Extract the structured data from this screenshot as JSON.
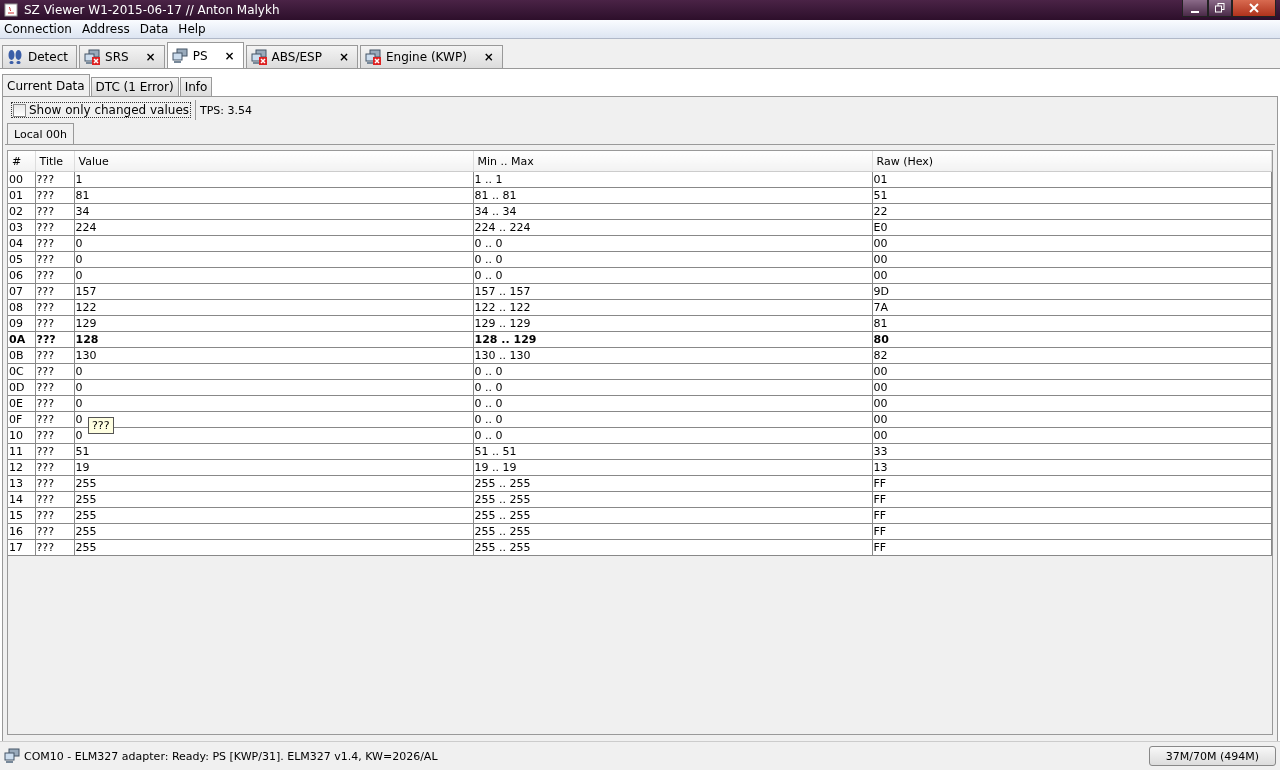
{
  "window": {
    "title": "SZ Viewer W1-2015-06-17 // Anton Malykh"
  },
  "menu": [
    "Connection",
    "Address",
    "Data",
    "Help"
  ],
  "device_tabs": [
    {
      "label": "Detect",
      "kind": "detect",
      "closable": false,
      "selected": false
    },
    {
      "label": "SRS",
      "kind": "error",
      "closable": true,
      "selected": false
    },
    {
      "label": "PS",
      "kind": "ok",
      "closable": true,
      "selected": true
    },
    {
      "label": "ABS/ESP",
      "kind": "error",
      "closable": true,
      "selected": false
    },
    {
      "label": "Engine (KWP)",
      "kind": "error",
      "closable": true,
      "selected": false
    }
  ],
  "close_glyph": "×",
  "sub_tabs": [
    {
      "label": "Current Data",
      "selected": true
    },
    {
      "label": "DTC (1 Error)",
      "selected": false
    },
    {
      "label": "Info",
      "selected": false
    }
  ],
  "filter": {
    "label": "Show only changed values",
    "checked": false
  },
  "tps": "TPS: 3.54",
  "block_tabs": [
    {
      "label": "Local 00h",
      "selected": true
    }
  ],
  "table": {
    "columns": [
      "#",
      "Title",
      "Value",
      "Min .. Max",
      "Raw (Hex)"
    ],
    "rows": [
      {
        "cells": [
          "00",
          "???",
          "1",
          "1 .. 1",
          "01"
        ],
        "bold": false
      },
      {
        "cells": [
          "01",
          "???",
          "81",
          "81 .. 81",
          "51"
        ],
        "bold": false
      },
      {
        "cells": [
          "02",
          "???",
          "34",
          "34 .. 34",
          "22"
        ],
        "bold": false
      },
      {
        "cells": [
          "03",
          "???",
          "224",
          "224 .. 224",
          "E0"
        ],
        "bold": false
      },
      {
        "cells": [
          "04",
          "???",
          "0",
          "0 .. 0",
          "00"
        ],
        "bold": false
      },
      {
        "cells": [
          "05",
          "???",
          "0",
          "0 .. 0",
          "00"
        ],
        "bold": false
      },
      {
        "cells": [
          "06",
          "???",
          "0",
          "0 .. 0",
          "00"
        ],
        "bold": false
      },
      {
        "cells": [
          "07",
          "???",
          "157",
          "157 .. 157",
          "9D"
        ],
        "bold": false
      },
      {
        "cells": [
          "08",
          "???",
          "122",
          "122 .. 122",
          "7A"
        ],
        "bold": false
      },
      {
        "cells": [
          "09",
          "???",
          "129",
          "129 .. 129",
          "81"
        ],
        "bold": false
      },
      {
        "cells": [
          "0A",
          "???",
          "128",
          "128 .. 129",
          "80"
        ],
        "bold": true
      },
      {
        "cells": [
          "0B",
          "???",
          "130",
          "130 .. 130",
          "82"
        ],
        "bold": false
      },
      {
        "cells": [
          "0C",
          "???",
          "0",
          "0 .. 0",
          "00"
        ],
        "bold": false
      },
      {
        "cells": [
          "0D",
          "???",
          "0",
          "0 .. 0",
          "00"
        ],
        "bold": false
      },
      {
        "cells": [
          "0E",
          "???",
          "0",
          "0 .. 0",
          "00"
        ],
        "bold": false
      },
      {
        "cells": [
          "0F",
          "???",
          "0",
          "0 .. 0",
          "00"
        ],
        "bold": false
      },
      {
        "cells": [
          "10",
          "???",
          "0",
          "0 .. 0",
          "00"
        ],
        "bold": false
      },
      {
        "cells": [
          "11",
          "???",
          "51",
          "51 .. 51",
          "33"
        ],
        "bold": false
      },
      {
        "cells": [
          "12",
          "???",
          "19",
          "19 .. 19",
          "13"
        ],
        "bold": false
      },
      {
        "cells": [
          "13",
          "???",
          "255",
          "255 .. 255",
          "FF"
        ],
        "bold": false
      },
      {
        "cells": [
          "14",
          "???",
          "255",
          "255 .. 255",
          "FF"
        ],
        "bold": false
      },
      {
        "cells": [
          "15",
          "???",
          "255",
          "255 .. 255",
          "FF"
        ],
        "bold": false
      },
      {
        "cells": [
          "16",
          "???",
          "255",
          "255 .. 255",
          "FF"
        ],
        "bold": false
      },
      {
        "cells": [
          "17",
          "???",
          "255",
          "255 .. 255",
          "FF"
        ],
        "bold": false
      }
    ]
  },
  "tooltip": "???",
  "status_bar": {
    "text": "COM10 - ELM327 adapter: Ready: PS [KWP/31]. ELM327 v1.4, KW=2026/AL",
    "memory": "37M/70M (494M)"
  }
}
